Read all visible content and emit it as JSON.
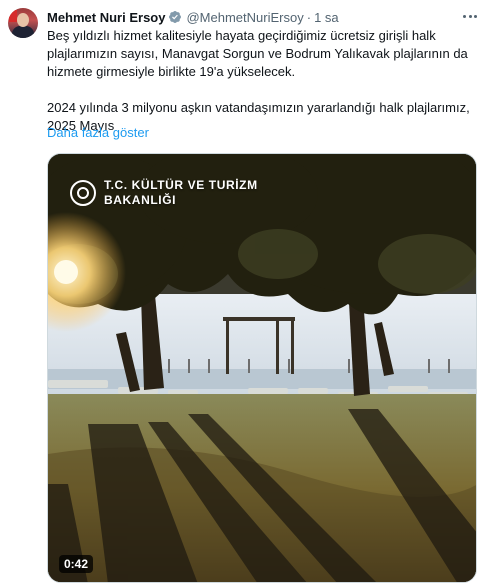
{
  "user": {
    "display_name": "Mehmet Nuri Ersoy",
    "handle": "@MehmetNuriErsoy",
    "separator": "·",
    "time": "1 sa",
    "verified_icon": "verified-badge-icon",
    "verified_color": "#829aab"
  },
  "tweet": {
    "paragraph1": "Beş yıldızlı hizmet kalitesiyle hayata geçirdiğimiz ücretsiz girişli halk plajlarımızın sayısı, Manavgat Sorgun ve Bodrum Yalıkavak plajlarının da hizmete girmesiyle birlikte 19'a yükselecek.",
    "paragraph2": "2024 yılında 3 milyonu aşkın vatandaşımızın yararlandığı halk plajlarımız, 2025 Mayıs",
    "show_more": "Daha fazla göster",
    "link_color": "#1d9bf0"
  },
  "media": {
    "overlay_line1": "T.C. KÜLTÜR VE TURİZM",
    "overlay_line2": "BAKANLIĞI",
    "emblem_icon": "ministry-emblem-icon",
    "duration": "0:42"
  },
  "menu": {
    "icon": "more-options-icon"
  }
}
